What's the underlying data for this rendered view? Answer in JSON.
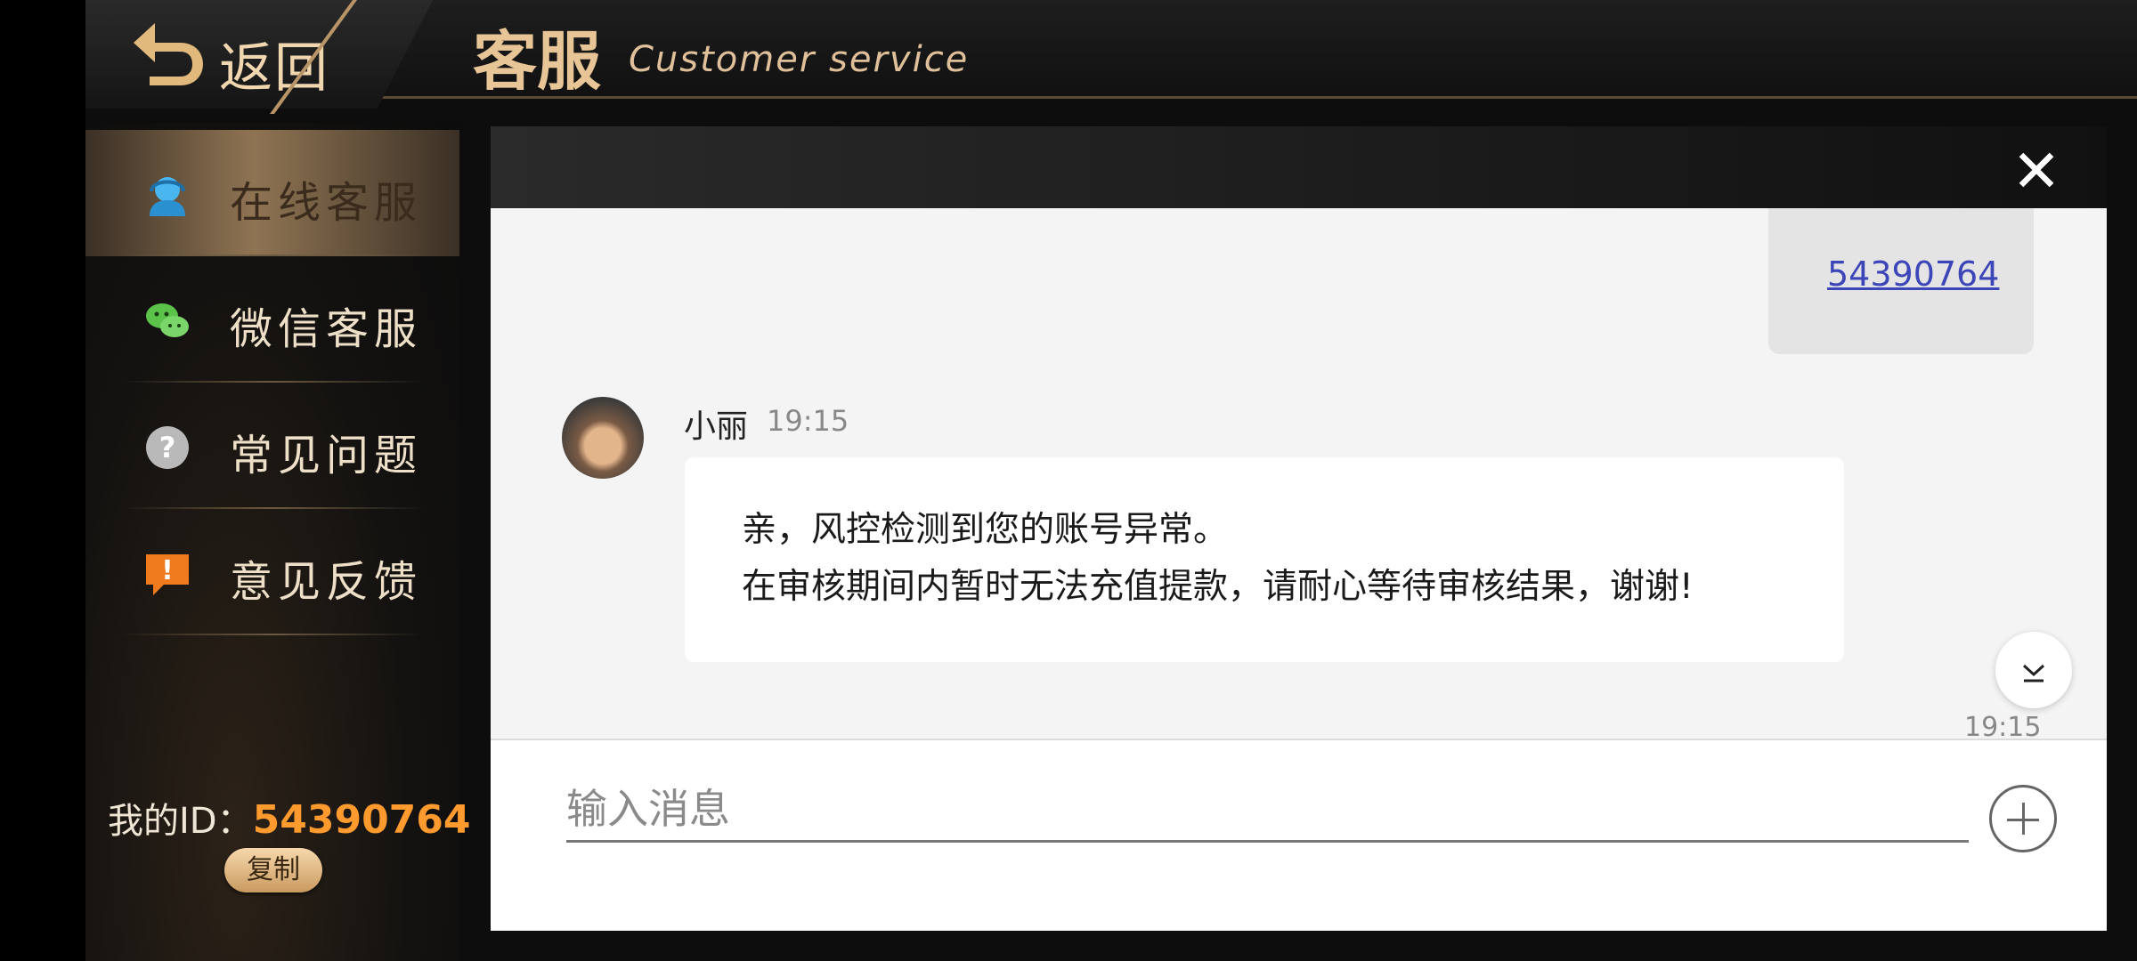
{
  "header": {
    "back_label": "返回",
    "title_cn": "客服",
    "title_en": "Customer service"
  },
  "sidebar": {
    "items": [
      {
        "label": "在线客服",
        "icon": "headset-icon",
        "active": true
      },
      {
        "label": "微信客服",
        "icon": "wechat-icon",
        "active": false
      },
      {
        "label": "常见问题",
        "icon": "question-icon",
        "active": false
      },
      {
        "label": "意见反馈",
        "icon": "feedback-icon",
        "active": false
      }
    ],
    "my_id_label": "我的ID：",
    "my_id_value": "54390764",
    "copy_label": "复制"
  },
  "chat": {
    "my_message": "54390764",
    "agent_name": "小丽",
    "agent_time": "19:15",
    "agent_message_line1": "亲，风控检测到您的账号异常。",
    "agent_message_line2": "在审核期间内暂时无法充值提款，请耐心等待审核结果，谢谢!",
    "bottom_time": "19:15"
  },
  "input": {
    "placeholder": "输入消息",
    "value": ""
  },
  "colors": {
    "accent_gold": "#e8c596",
    "id_orange": "#ff9a2e",
    "link_blue": "#3d46b8"
  }
}
